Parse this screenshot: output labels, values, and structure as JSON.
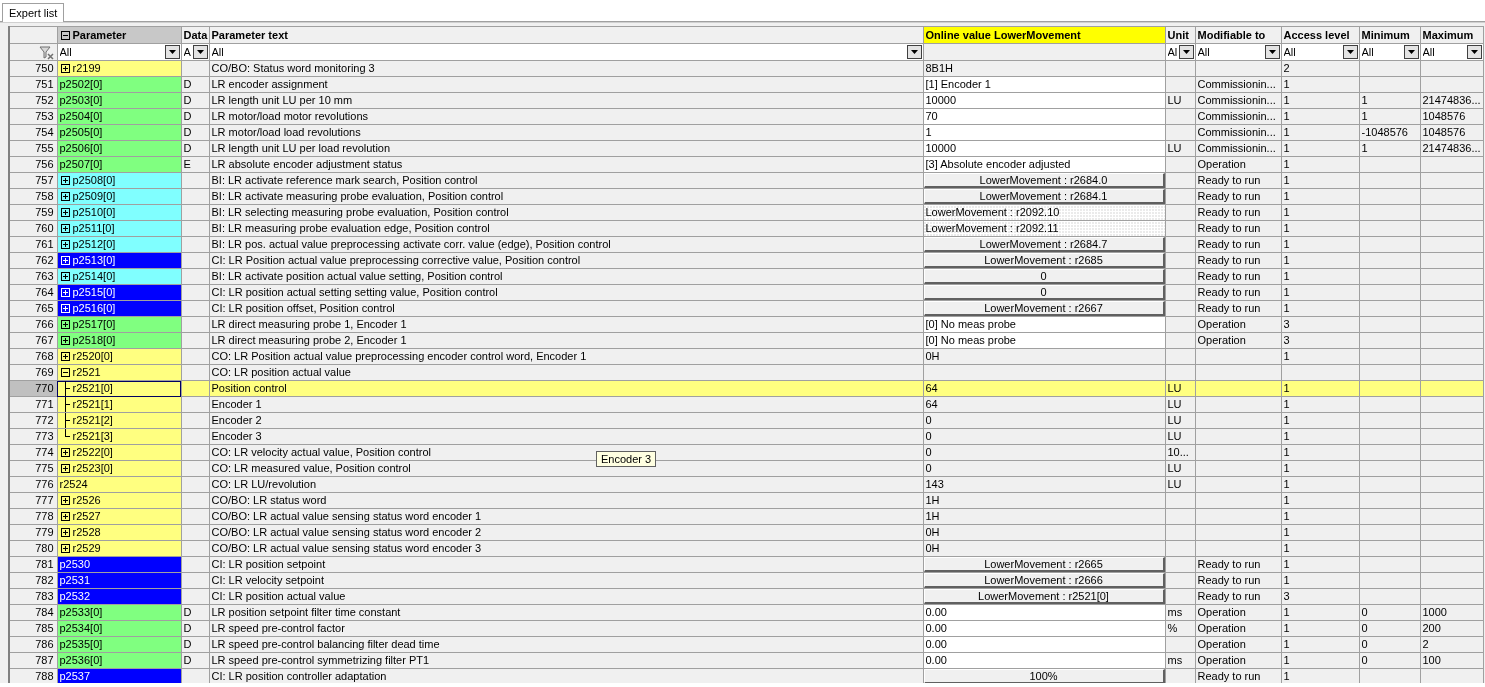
{
  "tabs": [
    {
      "label": "Expert list",
      "selected": true
    }
  ],
  "table": {
    "columns": [
      {
        "label": "Parameter",
        "filter": "All",
        "expanded": true,
        "highlight": false,
        "sorted": true
      },
      {
        "label": "Data",
        "filter": "A",
        "highlight": false,
        "sorted": false
      },
      {
        "label": "Parameter text",
        "filter": "All",
        "highlight": false,
        "sorted": false
      },
      {
        "label": "Online value LowerMovement",
        "highlight": true,
        "sorted": false
      },
      {
        "label": "Unit",
        "filter": "Al",
        "highlight": false,
        "sorted": false
      },
      {
        "label": "Modifiable to",
        "filter": "All",
        "highlight": false,
        "sorted": false
      },
      {
        "label": "Access level",
        "filter": "All",
        "highlight": false,
        "sorted": false
      },
      {
        "label": "Minimum",
        "filter": "All",
        "highlight": false,
        "sorted": false
      },
      {
        "label": "Maximum",
        "filter": "All",
        "highlight": false,
        "sorted": false
      }
    ],
    "rows": [
      {
        "no": "750",
        "param": "r2199",
        "color": "#ffff80",
        "expanded": false,
        "text": "CO/BO: Status word monitoring 3",
        "value": "8B1H",
        "kind": "text",
        "access": "2",
        "selected": false
      },
      {
        "no": "751",
        "param": "p2502[0]",
        "color": "#80ff80",
        "data": "D",
        "text": "LR encoder assignment",
        "value": "[1] Encoder 1",
        "kind": "field",
        "modifiable": "Commissionin...",
        "access": "1",
        "selected": false
      },
      {
        "no": "752",
        "param": "p2503[0]",
        "color": "#80ff80",
        "data": "D",
        "text": "LR length unit LU per 10 mm",
        "value": "10000",
        "kind": "field",
        "unit": "LU",
        "modifiable": "Commissionin...",
        "access": "1",
        "min": "1",
        "max": "21474836...",
        "selected": false
      },
      {
        "no": "753",
        "param": "p2504[0]",
        "color": "#80ff80",
        "data": "D",
        "text": "LR motor/load motor revolutions",
        "value": "70",
        "kind": "field",
        "modifiable": "Commissionin...",
        "access": "1",
        "min": "1",
        "max": "1048576",
        "selected": false
      },
      {
        "no": "754",
        "param": "p2505[0]",
        "color": "#80ff80",
        "data": "D",
        "text": "LR motor/load load revolutions",
        "value": "1",
        "kind": "field",
        "modifiable": "Commissionin...",
        "access": "1",
        "min": "-1048576",
        "max": "1048576",
        "selected": false
      },
      {
        "no": "755",
        "param": "p2506[0]",
        "color": "#80ff80",
        "data": "D",
        "text": "LR length unit LU per load revolution",
        "value": "10000",
        "kind": "field",
        "unit": "LU",
        "modifiable": "Commissionin...",
        "access": "1",
        "min": "1",
        "max": "21474836...",
        "selected": false
      },
      {
        "no": "756",
        "param": "p2507[0]",
        "color": "#80ff80",
        "data": "E",
        "text": "LR absolute encoder adjustment status",
        "value": "[3] Absolute encoder adjusted",
        "kind": "field",
        "modifiable": "Operation",
        "access": "1",
        "selected": false
      },
      {
        "no": "757",
        "param": "p2508[0]",
        "color": "#80ffff",
        "expanded": false,
        "text": "BI: LR activate reference mark search, Position control",
        "value": "LowerMovement : r2684.0",
        "kind": "link",
        "modifiable": "Ready to run",
        "access": "1",
        "selected": false
      },
      {
        "no": "758",
        "param": "p2509[0]",
        "color": "#80ffff",
        "expanded": false,
        "text": "BI: LR activate measuring probe evaluation, Position control",
        "value": "LowerMovement : r2684.1",
        "kind": "link",
        "modifiable": "Ready to run",
        "access": "1",
        "selected": false
      },
      {
        "no": "759",
        "param": "p2510[0]",
        "color": "#80ffff",
        "expanded": false,
        "text": "BI: LR selecting measuring probe evaluation, Position control",
        "value": "LowerMovement : r2092.10",
        "kind": "hatched",
        "modifiable": "Ready to run",
        "access": "1",
        "selected": false
      },
      {
        "no": "760",
        "param": "p2511[0]",
        "color": "#80ffff",
        "expanded": false,
        "text": "BI: LR measuring probe evaluation edge, Position control",
        "value": "LowerMovement : r2092.11",
        "kind": "hatched",
        "modifiable": "Ready to run",
        "access": "1",
        "selected": false
      },
      {
        "no": "761",
        "param": "p2512[0]",
        "color": "#80ffff",
        "expanded": false,
        "text": "BI: LR pos. actual value preprocessing activate corr. value (edge), Position control",
        "value": "LowerMovement : r2684.7",
        "kind": "link",
        "modifiable": "Ready to run",
        "access": "1",
        "selected": false
      },
      {
        "no": "762",
        "param": "p2513[0]",
        "color": "#0000ff",
        "expanded": false,
        "text": "CI: LR Position actual value preprocessing corrective value, Position control",
        "value": "LowerMovement : r2685",
        "kind": "link",
        "modifiable": "Ready to run",
        "access": "1",
        "selected": false
      },
      {
        "no": "763",
        "param": "p2514[0]",
        "color": "#80ffff",
        "expanded": false,
        "text": "BI: LR activate position actual value setting, Position control",
        "value": "0",
        "kind": "link",
        "modifiable": "Ready to run",
        "access": "1",
        "selected": false
      },
      {
        "no": "764",
        "param": "p2515[0]",
        "color": "#0000ff",
        "expanded": false,
        "text": "CI: LR position actual setting setting value, Position control",
        "value": "0",
        "kind": "link",
        "modifiable": "Ready to run",
        "access": "1",
        "selected": false
      },
      {
        "no": "765",
        "param": "p2516[0]",
        "color": "#0000ff",
        "expanded": false,
        "text": "CI: LR position offset, Position control",
        "value": "LowerMovement : r2667",
        "kind": "link",
        "modifiable": "Ready to run",
        "access": "1",
        "selected": false
      },
      {
        "no": "766",
        "param": "p2517[0]",
        "color": "#80ff80",
        "expanded": false,
        "text": "LR direct measuring probe 1, Encoder 1",
        "value": "[0] No meas probe",
        "kind": "field",
        "modifiable": "Operation",
        "access": "3",
        "selected": false
      },
      {
        "no": "767",
        "param": "p2518[0]",
        "color": "#80ff80",
        "expanded": false,
        "text": "LR direct measuring probe 2, Encoder 1",
        "value": "[0] No meas probe",
        "kind": "field",
        "modifiable": "Operation",
        "access": "3",
        "selected": false
      },
      {
        "no": "768",
        "param": "r2520[0]",
        "color": "#ffff80",
        "expanded": false,
        "text": "CO: LR Position actual value preprocessing encoder control word, Encoder 1",
        "value": "0H",
        "kind": "text",
        "access": "1",
        "selected": false
      },
      {
        "no": "769",
        "param": "r2521",
        "color": "#ffff80",
        "expanded": true,
        "text": "CO: LR position actual value",
        "kind": "text",
        "selected": false,
        "children": [
          {
            "no": "770",
            "param": "r2521[0]",
            "color": "#ffff80",
            "text": "Position control",
            "value": "64",
            "kind": "text",
            "unit": "LU",
            "access": "1",
            "selected": true
          },
          {
            "no": "771",
            "param": "r2521[1]",
            "color": "#ffff80",
            "text": "Encoder 1",
            "value": "64",
            "kind": "text",
            "unit": "LU",
            "access": "1",
            "selected": false
          },
          {
            "no": "772",
            "param": "r2521[2]",
            "color": "#ffff80",
            "text": "Encoder 2",
            "value": "0",
            "kind": "text",
            "unit": "LU",
            "access": "1",
            "selected": false
          },
          {
            "no": "773",
            "param": "r2521[3]",
            "color": "#ffff80",
            "text": "Encoder 3",
            "value": "0",
            "kind": "text",
            "unit": "LU",
            "access": "1",
            "selected": false
          }
        ]
      },
      {
        "no": "774",
        "param": "r2522[0]",
        "color": "#ffff80",
        "expanded": false,
        "text": "CO: LR velocity actual value, Position control",
        "value": "0",
        "kind": "text",
        "unit": "10...",
        "access": "1",
        "selected": false
      },
      {
        "no": "775",
        "param": "r2523[0]",
        "color": "#ffff80",
        "expanded": false,
        "text": "CO: LR measured value, Position control",
        "value": "0",
        "kind": "text",
        "unit": "LU",
        "access": "1",
        "selected": false
      },
      {
        "no": "776",
        "param": "r2524",
        "color": "#ffff80",
        "text": "CO: LR LU/revolution",
        "value": "143",
        "kind": "text",
        "unit": "LU",
        "access": "1",
        "selected": false
      },
      {
        "no": "777",
        "param": "r2526",
        "color": "#ffff80",
        "expanded": false,
        "text": "CO/BO: LR status word",
        "value": "1H",
        "kind": "text",
        "access": "1",
        "selected": false
      },
      {
        "no": "778",
        "param": "r2527",
        "color": "#ffff80",
        "expanded": false,
        "text": "CO/BO: LR actual value sensing status word encoder 1",
        "value": "1H",
        "kind": "text",
        "access": "1",
        "selected": false
      },
      {
        "no": "779",
        "param": "r2528",
        "color": "#ffff80",
        "expanded": false,
        "text": "CO/BO: LR actual value sensing status word encoder 2",
        "value": "0H",
        "kind": "text",
        "access": "1",
        "selected": false
      },
      {
        "no": "780",
        "param": "r2529",
        "color": "#ffff80",
        "expanded": false,
        "text": "CO/BO: LR actual value sensing status word encoder 3",
        "value": "0H",
        "kind": "text",
        "access": "1",
        "selected": false
      },
      {
        "no": "781",
        "param": "p2530",
        "color": "#0000ff",
        "text": "CI: LR position setpoint",
        "value": "LowerMovement : r2665",
        "kind": "link",
        "modifiable": "Ready to run",
        "access": "1",
        "selected": false
      },
      {
        "no": "782",
        "param": "p2531",
        "color": "#0000ff",
        "text": "CI: LR velocity setpoint",
        "value": "LowerMovement : r2666",
        "kind": "link",
        "modifiable": "Ready to run",
        "access": "1",
        "selected": false
      },
      {
        "no": "783",
        "param": "p2532",
        "color": "#0000ff",
        "text": "CI: LR position actual value",
        "value": "LowerMovement : r2521[0]",
        "kind": "link",
        "modifiable": "Ready to run",
        "access": "3",
        "selected": false
      },
      {
        "no": "784",
        "param": "p2533[0]",
        "color": "#80ff80",
        "data": "D",
        "text": "LR position setpoint filter time constant",
        "value": "0.00",
        "kind": "field",
        "unit": "ms",
        "modifiable": "Operation",
        "access": "1",
        "min": "0",
        "max": "1000",
        "selected": false
      },
      {
        "no": "785",
        "param": "p2534[0]",
        "color": "#80ff80",
        "data": "D",
        "text": "LR speed pre-control factor",
        "value": "0.00",
        "kind": "field",
        "unit": "%",
        "modifiable": "Operation",
        "access": "1",
        "min": "0",
        "max": "200",
        "selected": false
      },
      {
        "no": "786",
        "param": "p2535[0]",
        "color": "#80ff80",
        "data": "D",
        "text": "LR speed pre-control balancing filter dead time",
        "value": "0.00",
        "kind": "field",
        "modifiable": "Operation",
        "access": "1",
        "min": "0",
        "max": "2",
        "selected": false
      },
      {
        "no": "787",
        "param": "p2536[0]",
        "color": "#80ff80",
        "data": "D",
        "text": "LR speed pre-control symmetrizing filter PT1",
        "value": "0.00",
        "kind": "field",
        "unit": "ms",
        "modifiable": "Operation",
        "access": "1",
        "min": "0",
        "max": "100",
        "selected": false
      },
      {
        "no": "788",
        "param": "p2537",
        "color": "#0000ff",
        "text": "CI: LR position controller adaptation",
        "value": "100%",
        "kind": "link",
        "modifiable": "Ready to run",
        "access": "1",
        "selected": false
      }
    ]
  },
  "tooltip": "Encoder 3"
}
